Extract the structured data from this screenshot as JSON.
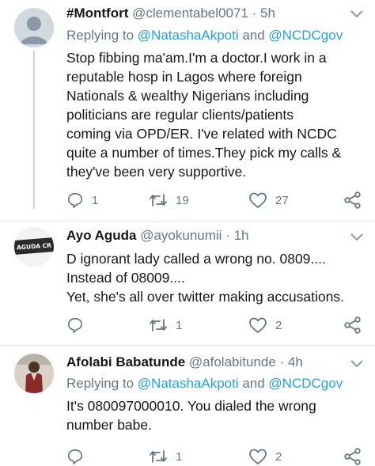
{
  "tweets": [
    {
      "name": "#Montfort",
      "handle": "@clementabel0071",
      "dot": "·",
      "time": "5h",
      "reply_prefix": "Replying to ",
      "reply_to_1": "@NatashaAkpoti",
      "reply_and": " and ",
      "reply_to_2": "@NCDCgov",
      "text": "Stop fibbing ma'am.I'm a doctor.I work in a\nreputable hosp in Lagos where foreign\nNationals & wealthy Nigerians including\npoliticians are regular clients/patients\ncoming via OPD/ER. I've related with NCDC\nquite a number of times.They pick my calls &\nthey've been very supportive.",
      "replies": "1",
      "retweets": "19",
      "likes": "27"
    },
    {
      "name": "Ayo Aguda",
      "handle": "@ayokunumii",
      "dot": "·",
      "time": "1h",
      "avatar_text": "AGUDA CR",
      "text": "D ignorant lady called a wrong no. 0809....\nInstead of 08009....\nYet, she's all over twitter making accusations.",
      "replies": "",
      "retweets": "1",
      "likes": "2"
    },
    {
      "name": "Afolabi Babatunde",
      "handle": "@afolabitunde",
      "dot": "·",
      "time": "4h",
      "reply_prefix": "Replying to ",
      "reply_to_1": "@NatashaAkpoti",
      "reply_and": " and ",
      "reply_to_2": "@NCDCgov",
      "text": "It's 080097000010. You dialed the wrong\nnumber babe.",
      "replies": "",
      "retweets": "1",
      "likes": "2"
    }
  ],
  "colors": {
    "accent": "#1da1f2",
    "secondary_text": "#657786",
    "divider": "#e1e8ed"
  },
  "icons": [
    "reply-icon",
    "retweet-icon",
    "like-icon",
    "share-icon",
    "chevron-down-icon"
  ]
}
